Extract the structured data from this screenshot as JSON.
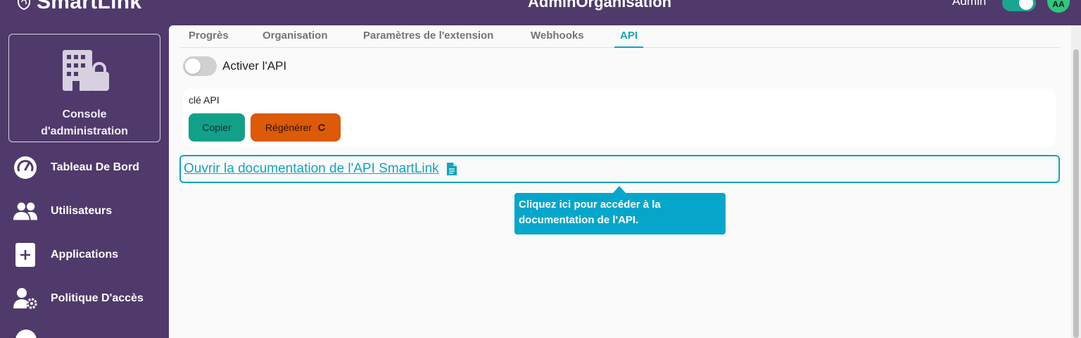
{
  "header": {
    "brand": "SmartLink",
    "org_title": "AdminOrganisation",
    "admin_label": "Admin",
    "avatar_initials": "AA"
  },
  "sidebar": {
    "console_label": "Console\nd'administration",
    "items": [
      {
        "label": "Tableau De Bord",
        "icon": "dashboard-gauge-icon"
      },
      {
        "label": "Utilisateurs",
        "icon": "users-icon"
      },
      {
        "label": "Applications",
        "icon": "add-app-icon"
      },
      {
        "label": "Politique D'accès",
        "icon": "user-gear-icon"
      }
    ]
  },
  "tabs": [
    {
      "label": "Progrès",
      "active": false
    },
    {
      "label": "Organisation",
      "active": false
    },
    {
      "label": "Paramètres de l'extension",
      "active": false
    },
    {
      "label": "Webhooks",
      "active": false
    },
    {
      "label": "API",
      "active": true
    }
  ],
  "api": {
    "toggle_label": "Activer l'API",
    "toggle_on": false,
    "key_label": "clé API",
    "copy_label": "Copier",
    "regen_label": "Régénérer",
    "doc_link": "Ouvrir la documentation de l'API SmartLink",
    "tooltip": "Cliquez ici pour accéder à la\ndocumentation de l'API."
  },
  "colors": {
    "primary_purple": "#4f3a6b",
    "accent_teal": "#12a4bd",
    "copy_button": "#13a08a",
    "regen_button": "#dc5a08",
    "tooltip_bg": "#06a6cb",
    "avatar_bg": "#2ec77e"
  }
}
